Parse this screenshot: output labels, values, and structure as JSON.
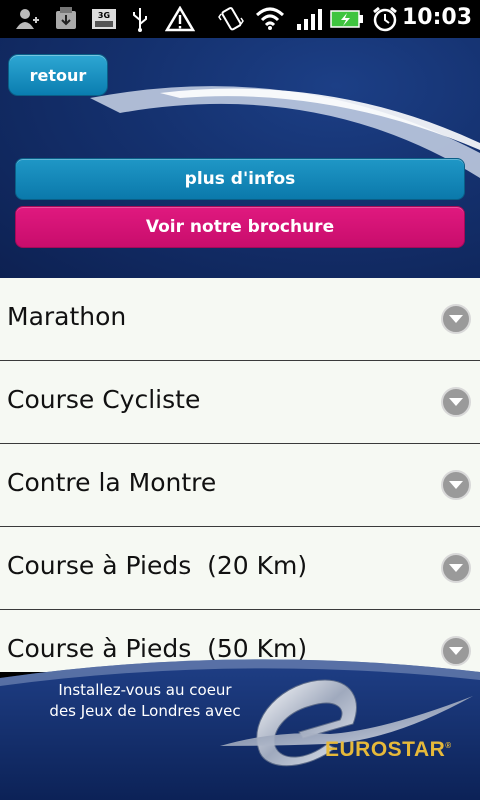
{
  "status_bar": {
    "time": "10:03",
    "network_label": "3G",
    "icons": [
      "add-contact-icon",
      "download-icon",
      "3g-icon",
      "usb-icon",
      "warning-icon",
      "vibrate-icon",
      "wifi-icon",
      "signal-icon",
      "battery-charging-icon",
      "alarm-icon"
    ]
  },
  "header": {
    "back_label": "retour",
    "info_label": "plus d'infos",
    "brochure_label": "Voir notre brochure"
  },
  "list": {
    "items": [
      {
        "label": "Marathon"
      },
      {
        "label": "Course Cycliste"
      },
      {
        "label": "Contre la Montre"
      },
      {
        "label": "Course à Pieds  (20 Km)"
      },
      {
        "label": "Course à Pieds  (50 Km)"
      }
    ]
  },
  "footer": {
    "line1": "Installez-vous au coeur",
    "line2": "des Jeux de Londres avec",
    "brand": "EUROSTAR",
    "trademark": "®"
  },
  "colors": {
    "header_bg": "#14306d",
    "info_button": "#0b79ab",
    "brochure_button": "#c80d6c",
    "list_bg": "#f6f9f3",
    "brand_gold": "#e6b93a"
  }
}
